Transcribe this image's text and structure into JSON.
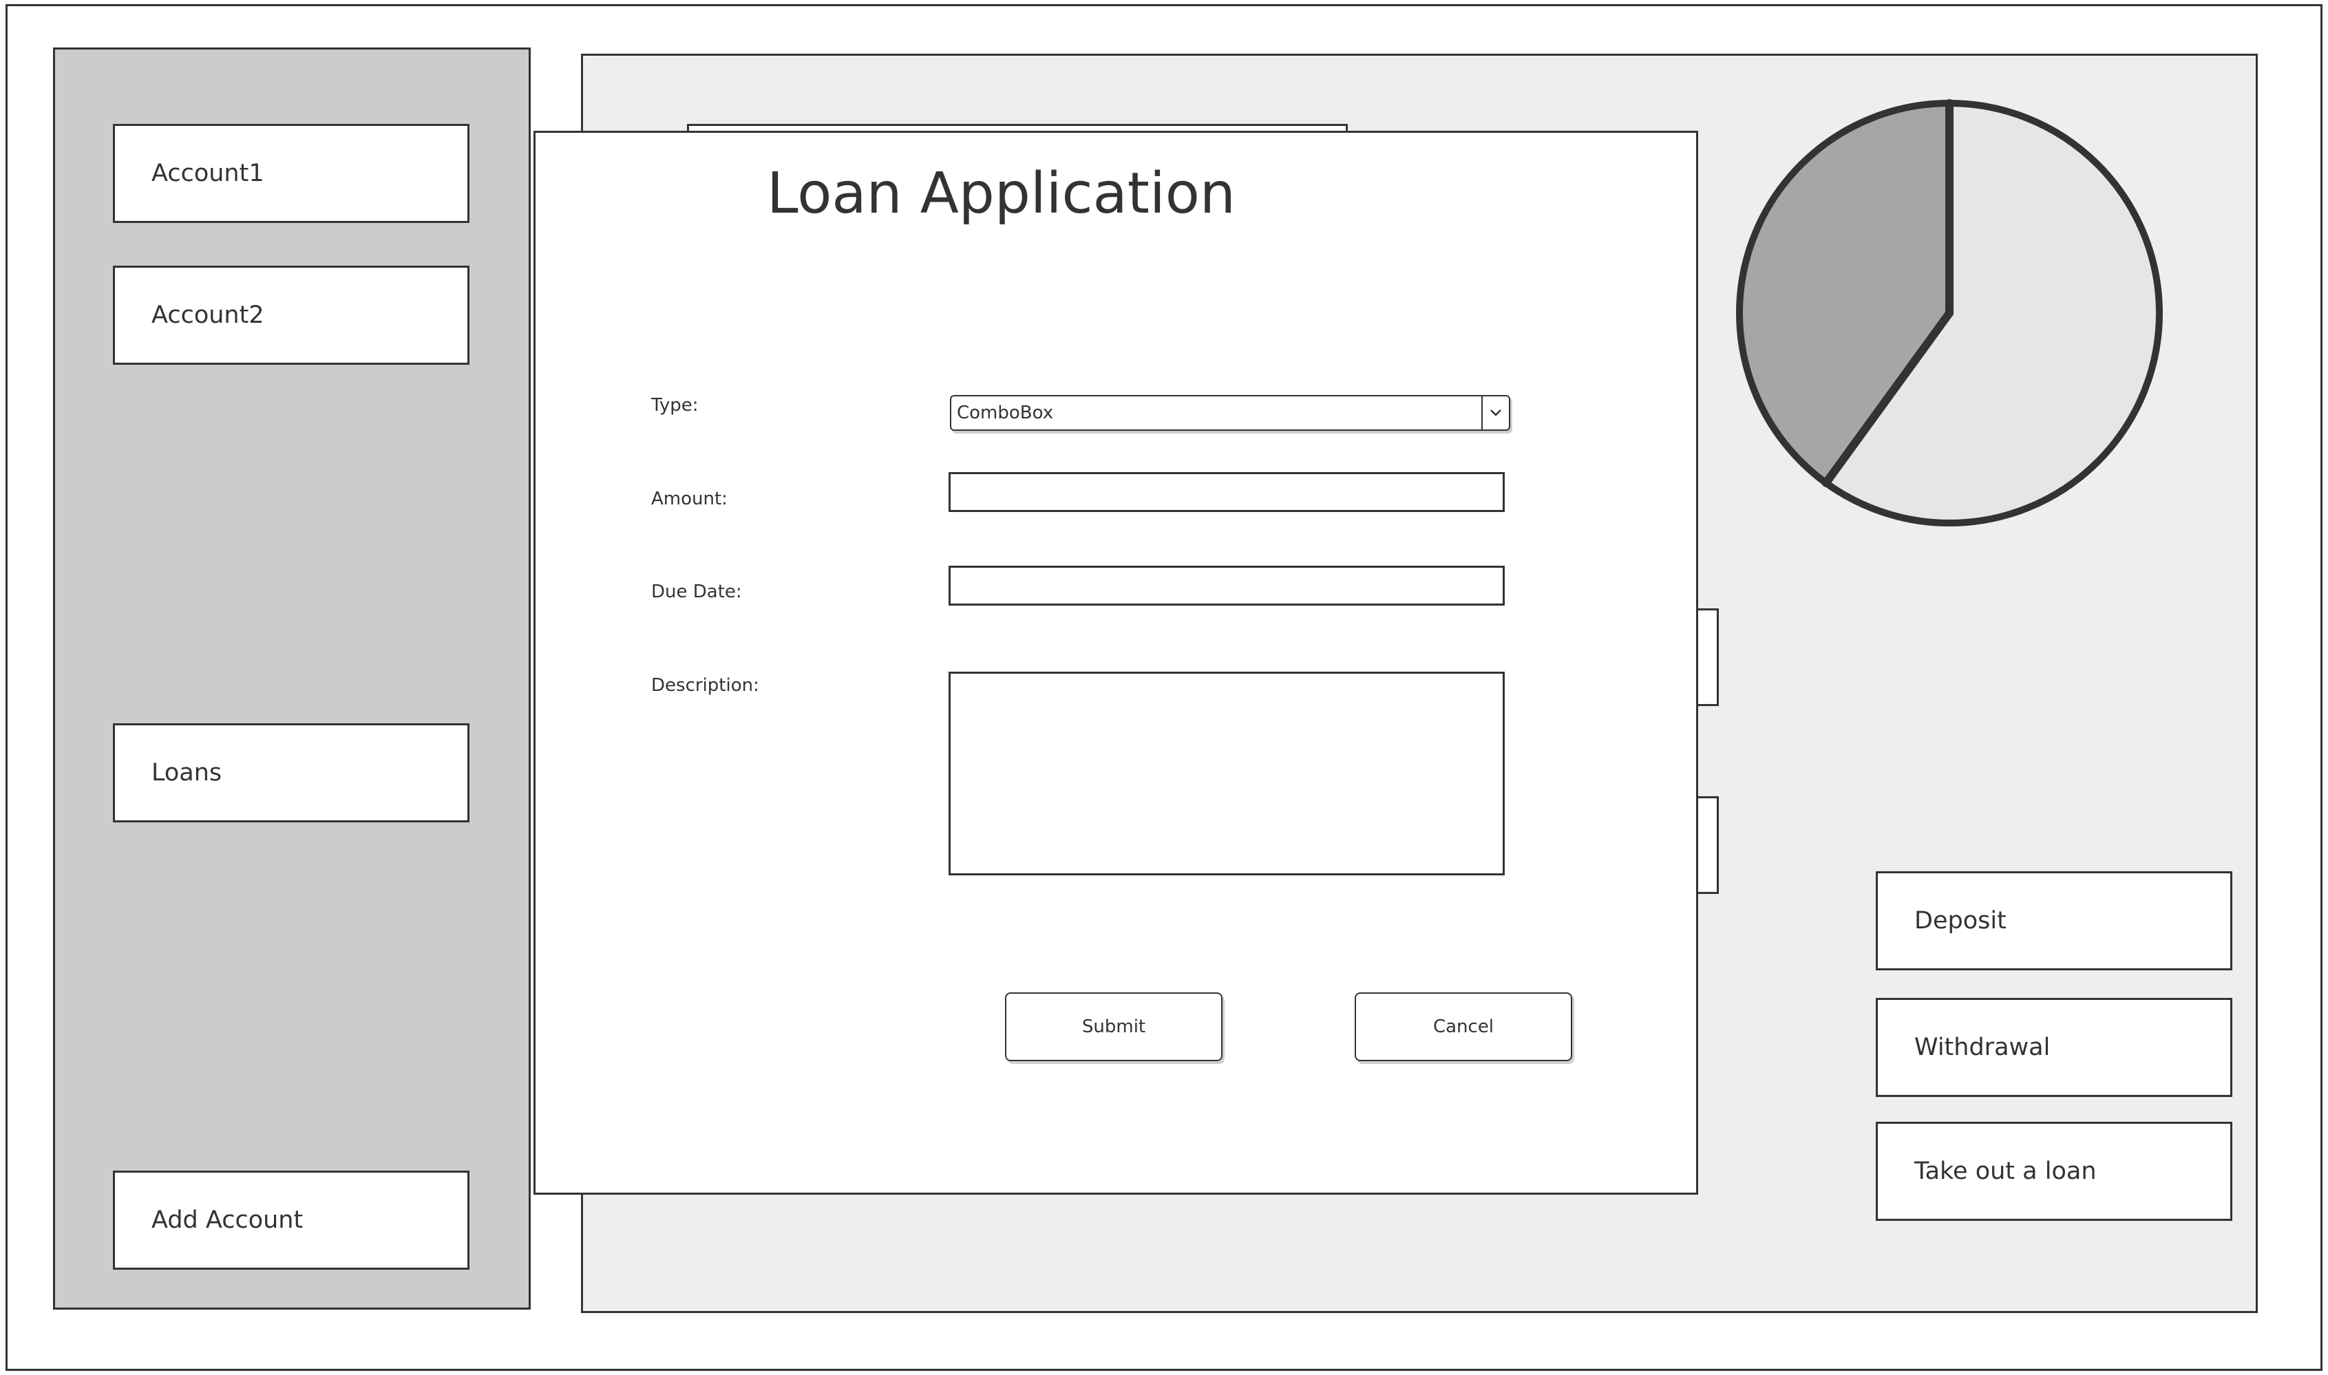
{
  "sidebar": {
    "accounts": [
      {
        "label": "Account1"
      },
      {
        "label": "Account2"
      }
    ],
    "loans_label": "Loans",
    "add_account_label": "Add Account"
  },
  "actions": {
    "deposit_label": "Deposit",
    "withdrawal_label": "Withdrawal",
    "loan_label": "Take out a loan"
  },
  "pie": {
    "slices": [
      0.6,
      0.4
    ],
    "colors": [
      "#e6e6e6",
      "#a6a6a6"
    ]
  },
  "dialog": {
    "title": "Loan Application",
    "labels": {
      "type": "Type:",
      "amount": "Amount:",
      "due_date": "Due Date:",
      "description": "Description:"
    },
    "type_value": "ComboBox",
    "amount_value": "",
    "due_date_value": "",
    "description_value": "",
    "submit_label": "Submit",
    "cancel_label": "Cancel"
  },
  "colors": {
    "sidebar_bg": "#cccccc",
    "main_bg": "#eeeeee",
    "stroke": "#333333"
  }
}
